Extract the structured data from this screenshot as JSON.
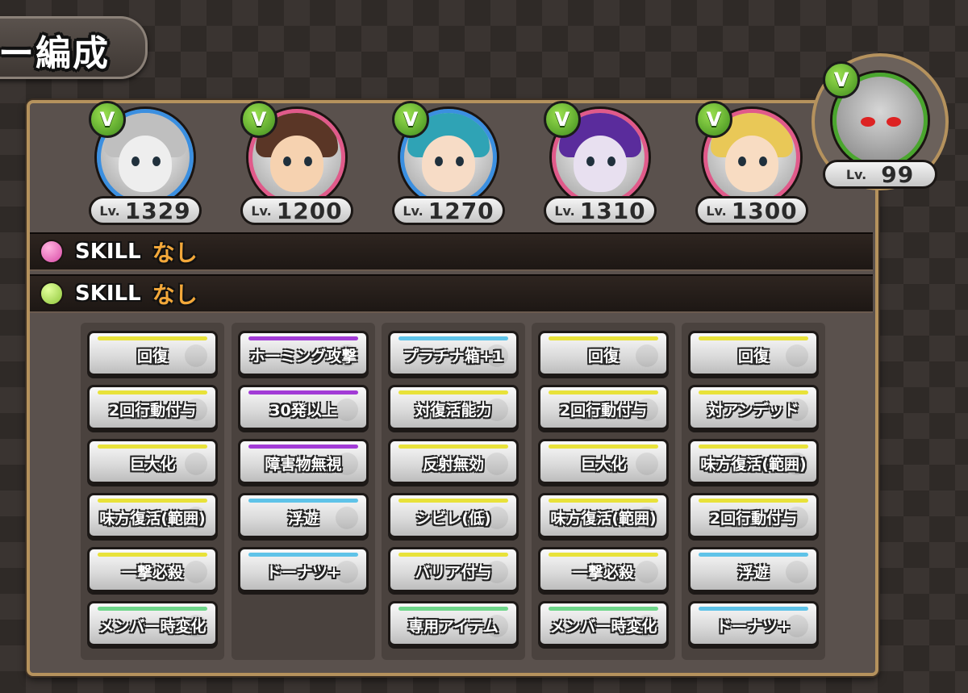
{
  "header": {
    "title": "ー編成"
  },
  "members": [
    {
      "level_label": "Lv.",
      "level": "1329",
      "ring_color": "#3b8fe0",
      "face_color": "#eeeeee",
      "hair_color": "#bfbfbf"
    },
    {
      "level_label": "Lv.",
      "level": "1200",
      "ring_color": "#e05a8a",
      "face_color": "#f6d2b0",
      "hair_color": "#5a3626"
    },
    {
      "level_label": "Lv.",
      "level": "1270",
      "ring_color": "#3b8fe0",
      "face_color": "#f7dcc6",
      "hair_color": "#2fa3b5"
    },
    {
      "level_label": "Lv.",
      "level": "1310",
      "ring_color": "#e05a8a",
      "face_color": "#e8e0f0",
      "hair_color": "#5a2c9c"
    },
    {
      "level_label": "Lv.",
      "level": "1300",
      "ring_color": "#e05a8a",
      "face_color": "#f8dcc2",
      "hair_color": "#e9c857"
    }
  ],
  "leader": {
    "level_label": "Lv.",
    "level": "99"
  },
  "skills": [
    {
      "label": "SKILL",
      "value": "なし",
      "orb_color": "#d94aa6"
    },
    {
      "label": "SKILL",
      "value": "なし",
      "orb_color": "#8ec63a"
    }
  ],
  "stripe_colors": {
    "yellow": "#e8e23a",
    "purple": "#a23bd6",
    "blue": "#5fc3e8",
    "green": "#6fd68a"
  },
  "ability_columns": [
    [
      {
        "text": "回復",
        "stripe": "yellow"
      },
      {
        "text": "2回行動付与",
        "stripe": "yellow"
      },
      {
        "text": "巨大化",
        "stripe": "yellow"
      },
      {
        "text": "味方復活(範囲)",
        "stripe": "yellow"
      },
      {
        "text": "一撃必殺",
        "stripe": "yellow"
      },
      {
        "text": "メンバー時変化",
        "stripe": "green"
      }
    ],
    [
      {
        "text": "ホーミング攻撃",
        "stripe": "purple"
      },
      {
        "text": "30発以上",
        "stripe": "purple"
      },
      {
        "text": "障害物無視",
        "stripe": "purple"
      },
      {
        "text": "浮遊",
        "stripe": "blue"
      },
      {
        "text": "ドーナツ+",
        "stripe": "blue"
      }
    ],
    [
      {
        "text": "プラチナ箱+1",
        "stripe": "blue"
      },
      {
        "text": "対復活能力",
        "stripe": "yellow"
      },
      {
        "text": "反射無効",
        "stripe": "yellow"
      },
      {
        "text": "シビレ(低)",
        "stripe": "yellow"
      },
      {
        "text": "バリア付与",
        "stripe": "yellow"
      },
      {
        "text": "専用アイテム",
        "stripe": "green"
      }
    ],
    [
      {
        "text": "回復",
        "stripe": "yellow"
      },
      {
        "text": "2回行動付与",
        "stripe": "yellow"
      },
      {
        "text": "巨大化",
        "stripe": "yellow"
      },
      {
        "text": "味方復活(範囲)",
        "stripe": "yellow"
      },
      {
        "text": "一撃必殺",
        "stripe": "yellow"
      },
      {
        "text": "メンバー時変化",
        "stripe": "green"
      }
    ],
    [
      {
        "text": "回復",
        "stripe": "yellow"
      },
      {
        "text": "対アンデッド",
        "stripe": "yellow"
      },
      {
        "text": "味方復活(範囲)",
        "stripe": "yellow"
      },
      {
        "text": "2回行動付与",
        "stripe": "yellow"
      },
      {
        "text": "浮遊",
        "stripe": "blue"
      },
      {
        "text": "ドーナツ+",
        "stripe": "blue"
      }
    ]
  ]
}
